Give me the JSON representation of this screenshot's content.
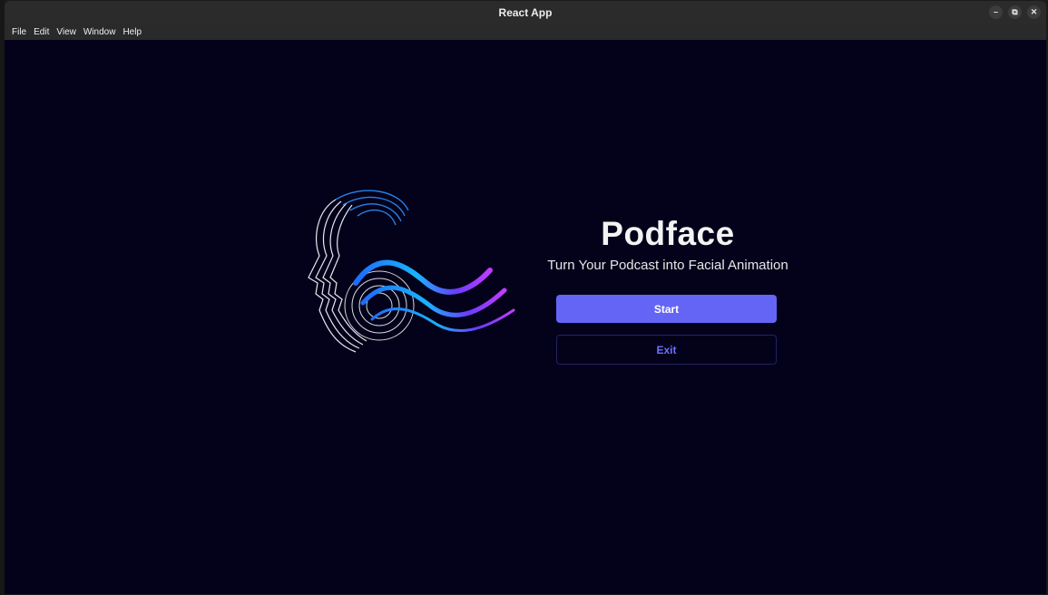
{
  "window": {
    "title": "React App",
    "controls": [
      "minimize-icon",
      "restore-icon",
      "close-icon"
    ]
  },
  "menubar": {
    "items": [
      "File",
      "Edit",
      "View",
      "Window",
      "Help"
    ]
  },
  "app": {
    "title": "Podface",
    "subtitle": "Turn Your Podcast into Facial Animation",
    "start_label": "Start",
    "exit_label": "Exit"
  },
  "colors": {
    "background": "#03021a",
    "accent": "#6465f5",
    "exit_text": "#6f70ff"
  }
}
